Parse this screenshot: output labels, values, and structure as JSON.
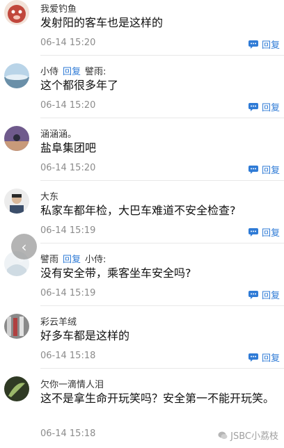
{
  "reply_label": "回复",
  "reply_tag": "回复",
  "comments": [
    {
      "user": "我爱钓鱼",
      "text": "发射阳的客车也是这样的",
      "time": "06-14 15:20",
      "avatar_color": "#b9443a"
    },
    {
      "user": "小侍",
      "reply_to": "譬雨:",
      "text": "这个都很多年了",
      "time": "06-14 15:20",
      "avatar_color": "#8fb8d8"
    },
    {
      "user": "涵涵涵。",
      "text": "盐阜集团吧",
      "time": "06-14 15:20",
      "avatar_color": "#8a6ca3"
    },
    {
      "user": "大东",
      "text": "私家车都年检，大巴车难道不安全检查?",
      "time": "06-14 15:19",
      "avatar_color": "#d8d8d8"
    },
    {
      "user": "譬雨",
      "reply_to": "小侍:",
      "text": "没有安全带，乘客坐车安全吗?",
      "time": "06-14 15:19",
      "avatar_color": "#e8eef3"
    },
    {
      "user": "彩云羊绒",
      "text": "好多车都是这样的",
      "time": "06-14 15:18",
      "avatar_color": "#7a7a7a"
    },
    {
      "user": "欠你一滴情人泪",
      "text": "这不是拿生命开玩笑吗？安全第一不能开玩笑。",
      "time": "06-14 15:18",
      "avatar_color": "#3c4a2e"
    }
  ],
  "watermark": "JSBC小荔枝",
  "icons": {
    "reply": "comment-bubble-icon",
    "back": "chevron-left-icon"
  }
}
